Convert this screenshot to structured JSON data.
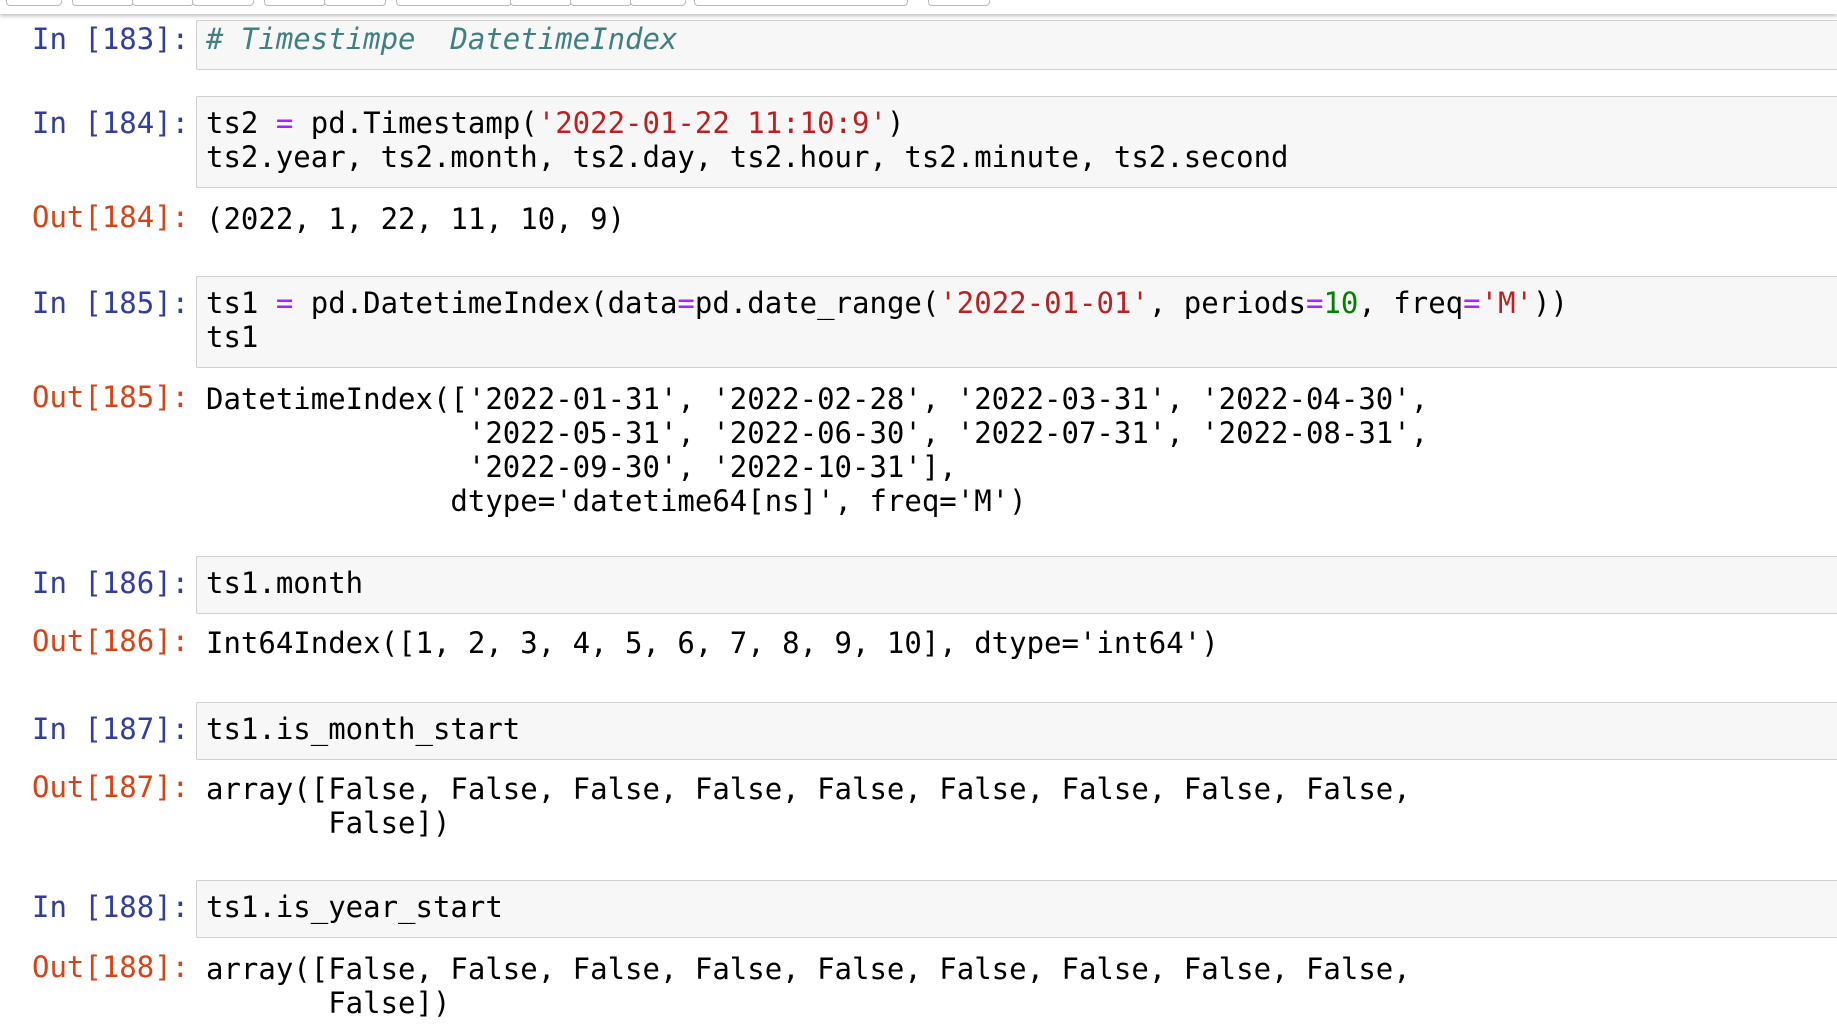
{
  "cells": [
    {
      "in_prompt": "In [183]:",
      "code": [
        {
          "t": "# Timestimpe  DatetimeIndex",
          "c": "comment"
        }
      ]
    },
    {
      "in_prompt": "In [184]:",
      "code": [
        {
          "t": "ts2 "
        },
        {
          "t": "=",
          "c": "operator"
        },
        {
          "t": " pd.Timestamp("
        },
        {
          "t": "'2022-01-22 11:10:9'",
          "c": "string"
        },
        {
          "t": ")\nts2.year, ts2.month, ts2.day, ts2.hour, ts2.minute, ts2.second"
        }
      ],
      "out_prompt": "Out[184]:",
      "output": "(2022, 1, 22, 11, 10, 9)"
    },
    {
      "in_prompt": "In [185]:",
      "code": [
        {
          "t": "ts1 "
        },
        {
          "t": "=",
          "c": "operator"
        },
        {
          "t": " pd.DatetimeIndex(data"
        },
        {
          "t": "=",
          "c": "operator"
        },
        {
          "t": "pd.date_range("
        },
        {
          "t": "'2022-01-01'",
          "c": "string"
        },
        {
          "t": ", periods"
        },
        {
          "t": "=",
          "c": "operator"
        },
        {
          "t": "10",
          "c": "number"
        },
        {
          "t": ", freq"
        },
        {
          "t": "=",
          "c": "operator"
        },
        {
          "t": "'M'",
          "c": "string"
        },
        {
          "t": "))\nts1"
        }
      ],
      "out_prompt": "Out[185]:",
      "output": "DatetimeIndex(['2022-01-31', '2022-02-28', '2022-03-31', '2022-04-30',\n               '2022-05-31', '2022-06-30', '2022-07-31', '2022-08-31',\n               '2022-09-30', '2022-10-31'],\n              dtype='datetime64[ns]', freq='M')"
    },
    {
      "in_prompt": "In [186]:",
      "code": [
        {
          "t": "ts1.month"
        }
      ],
      "out_prompt": "Out[186]:",
      "output": "Int64Index([1, 2, 3, 4, 5, 6, 7, 8, 9, 10], dtype='int64')"
    },
    {
      "in_prompt": "In [187]:",
      "code": [
        {
          "t": "ts1.is_month_start"
        }
      ],
      "out_prompt": "Out[187]:",
      "output": "array([False, False, False, False, False, False, False, False, False,\n       False])"
    },
    {
      "in_prompt": "In [188]:",
      "code": [
        {
          "t": "ts1.is_year_start"
        }
      ],
      "out_prompt": "Out[188]:",
      "output": "array([False, False, False, False, False, False, False, False, False,\n       False])"
    }
  ]
}
